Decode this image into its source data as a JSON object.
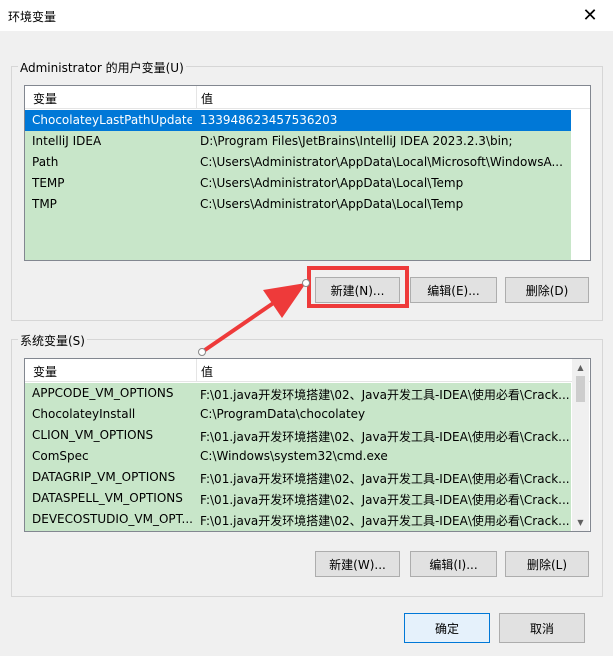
{
  "window": {
    "title": "环境变量",
    "close_symbol": "✕"
  },
  "user_group": {
    "label": "Administrator 的用户变量(U)",
    "columns": {
      "name": "变量",
      "value": "值"
    },
    "rows": [
      {
        "name": "ChocolateyLastPathUpdate",
        "value": "133948623457536203",
        "selected": true
      },
      {
        "name": "IntelliJ IDEA",
        "value": "D:\\Program Files\\JetBrains\\IntelliJ IDEA 2023.2.3\\bin;"
      },
      {
        "name": "Path",
        "value": "C:\\Users\\Administrator\\AppData\\Local\\Microsoft\\WindowsA..."
      },
      {
        "name": "TEMP",
        "value": "C:\\Users\\Administrator\\AppData\\Local\\Temp"
      },
      {
        "name": "TMP",
        "value": "C:\\Users\\Administrator\\AppData\\Local\\Temp"
      }
    ],
    "buttons": {
      "new": "新建(N)...",
      "edit": "编辑(E)...",
      "delete": "删除(D)"
    }
  },
  "system_group": {
    "label": "系统变量(S)",
    "columns": {
      "name": "变量",
      "value": "值"
    },
    "rows": [
      {
        "name": "APPCODE_VM_OPTIONS",
        "value": "F:\\01.java开发环境搭建\\02、Java开发工具-IDEA\\使用必看\\Crack..."
      },
      {
        "name": "ChocolateyInstall",
        "value": "C:\\ProgramData\\chocolatey"
      },
      {
        "name": "CLION_VM_OPTIONS",
        "value": "F:\\01.java开发环境搭建\\02、Java开发工具-IDEA\\使用必看\\Crack..."
      },
      {
        "name": "ComSpec",
        "value": "C:\\Windows\\system32\\cmd.exe"
      },
      {
        "name": "DATAGRIP_VM_OPTIONS",
        "value": "F:\\01.java开发环境搭建\\02、Java开发工具-IDEA\\使用必看\\Crack..."
      },
      {
        "name": "DATASPELL_VM_OPTIONS",
        "value": "F:\\01.java开发环境搭建\\02、Java开发工具-IDEA\\使用必看\\Crack..."
      },
      {
        "name": "DEVECOSTUDIO_VM_OPT...",
        "value": "F:\\01.java开发环境搭建\\02、Java开发工具-IDEA\\使用必看\\Crack..."
      }
    ],
    "buttons": {
      "new": "新建(W)...",
      "edit": "编辑(I)...",
      "delete": "删除(L)"
    }
  },
  "dialog_buttons": {
    "ok": "确定",
    "cancel": "取消"
  },
  "colors": {
    "accent": "#0078d7",
    "annotation": "#ee3a3a",
    "row_highlight": "#c8e6c9"
  }
}
